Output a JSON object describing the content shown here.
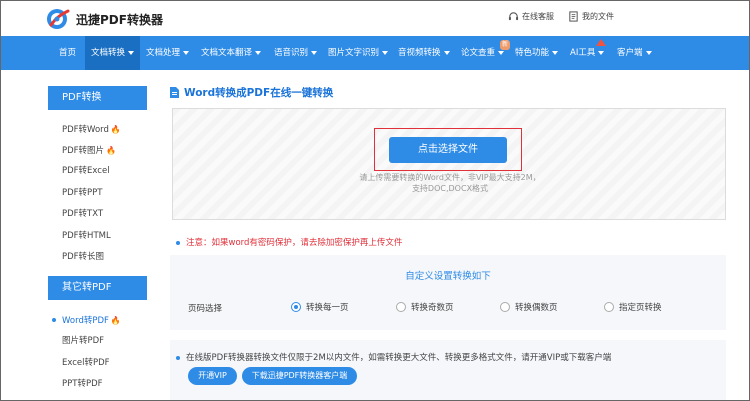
{
  "header": {
    "logo_text": "迅捷PDF转换器",
    "service_label": "在线客服",
    "files_label": "我的文件"
  },
  "nav": {
    "items": [
      {
        "label": "首页",
        "caret": false
      },
      {
        "label": "文档转换",
        "caret": true,
        "active": true
      },
      {
        "label": "文档处理",
        "caret": true
      },
      {
        "label": "文档文本翻译",
        "caret": true
      },
      {
        "label": "语音识别",
        "caret": true
      },
      {
        "label": "图片文字识别",
        "caret": true
      },
      {
        "label": "音视频转换",
        "caret": true
      },
      {
        "label": "论文查重",
        "caret": true
      },
      {
        "label": "特色功能",
        "caret": true
      },
      {
        "label": "AI工具",
        "caret": true
      },
      {
        "label": "客户端",
        "caret": true
      }
    ],
    "new_badge": "新"
  },
  "sidebar": {
    "group1_title": "PDF转换",
    "group1_items": [
      {
        "label": "PDF转Word",
        "hot": true
      },
      {
        "label": "PDF转图片",
        "hot": true
      },
      {
        "label": "PDF转Excel",
        "hot": false
      },
      {
        "label": "PDF转PPT",
        "hot": false
      },
      {
        "label": "PDF转TXT",
        "hot": false
      },
      {
        "label": "PDF转HTML",
        "hot": false
      },
      {
        "label": "PDF转长图",
        "hot": false
      }
    ],
    "group2_title": "其它转PDF",
    "group2_items": [
      {
        "label": "Word转PDF",
        "hot": true,
        "active": true
      },
      {
        "label": "图片转PDF",
        "hot": false
      },
      {
        "label": "Excel转PDF",
        "hot": false
      },
      {
        "label": "PPT转PDF",
        "hot": false
      }
    ]
  },
  "main": {
    "title": "Word转换成PDF在线一键转换",
    "select_button": "点击选择文件",
    "hint_line1": "请上传需要转换的Word文件，非VIP最大支持2M，",
    "hint_line2": "支持DOC,DOCX格式",
    "notice": "注意：如果word有密码保护，请去除加密保护再上传文件",
    "settings_title": "自定义设置转换如下",
    "settings_label": "页码选择",
    "radios": [
      {
        "label": "转换每一页",
        "checked": true
      },
      {
        "label": "转换奇数页",
        "checked": false
      },
      {
        "label": "转换偶数页",
        "checked": false
      },
      {
        "label": "指定页转换",
        "checked": false
      }
    ],
    "info_text": "在线版PDF转换器转换文件仅限于2M以内文件，如需转换更大文件、转换更多格式文件，请开通VIP或下载客户端",
    "vip_button": "开通VIP",
    "download_button": "下载迅捷PDF转换器客户端"
  },
  "colors": {
    "brand_blue": "#2e8be6",
    "nav_active": "#1a6fc2",
    "alert_red": "#e0303a",
    "hot_orange": "#f06a1c"
  }
}
